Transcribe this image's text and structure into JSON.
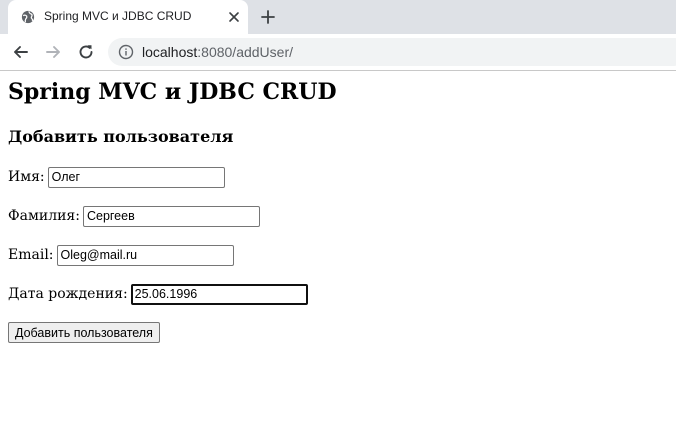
{
  "browser": {
    "tab": {
      "title": "Spring MVC и JDBC CRUD",
      "favicon": "globe-icon",
      "close_icon": "close-icon"
    },
    "new_tab_icon": "plus-icon",
    "nav": {
      "back_icon": "back-arrow-icon",
      "forward_icon": "forward-arrow-icon",
      "reload_icon": "reload-icon"
    },
    "address_bar": {
      "info_icon": "info-icon",
      "url_host": "localhost",
      "url_rest": ":8080/addUser/"
    },
    "colors": {
      "tabstrip": "#dee1e6",
      "omnibox": "#f1f3f4"
    }
  },
  "page": {
    "title": "Spring MVC и JDBC CRUD",
    "subtitle": "Добавить пользователя",
    "form": {
      "name": {
        "label": "Имя:",
        "value": "Олег"
      },
      "surname": {
        "label": "Фамилия:",
        "value": "Сергеев"
      },
      "email": {
        "label": "Email:",
        "value": "Oleg@mail.ru"
      },
      "birth_date": {
        "label": "Дата рождения:",
        "value": "25.06.1996"
      },
      "submit_label": "Добавить пользователя"
    }
  }
}
